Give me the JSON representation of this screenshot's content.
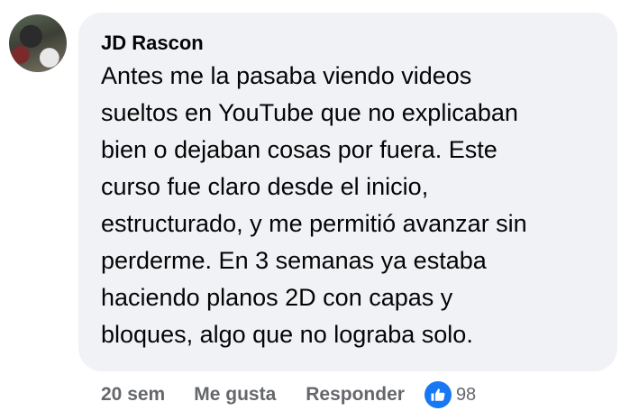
{
  "comment": {
    "author": "JD Rascon",
    "lines": [
      "Antes me la pasaba viendo videos",
      "sueltos en YouTube que no explicaban",
      "bien o dejaban cosas por fuera. Este",
      "curso fue claro desde el inicio,",
      "estructurado, y me permitió avanzar sin",
      "perderme. En 3 semanas ya estaba",
      "haciendo planos 2D con capas y",
      "bloques, algo que no lograba solo."
    ],
    "time": "20 sem",
    "like_label": "Me gusta",
    "reply_label": "Responder",
    "reaction_icon": "like-icon",
    "reaction_count": "98"
  },
  "colors": {
    "bubble": "#f0f2f5",
    "text": "#050505",
    "meta": "#65676b",
    "like_blue": "#1877f2"
  }
}
